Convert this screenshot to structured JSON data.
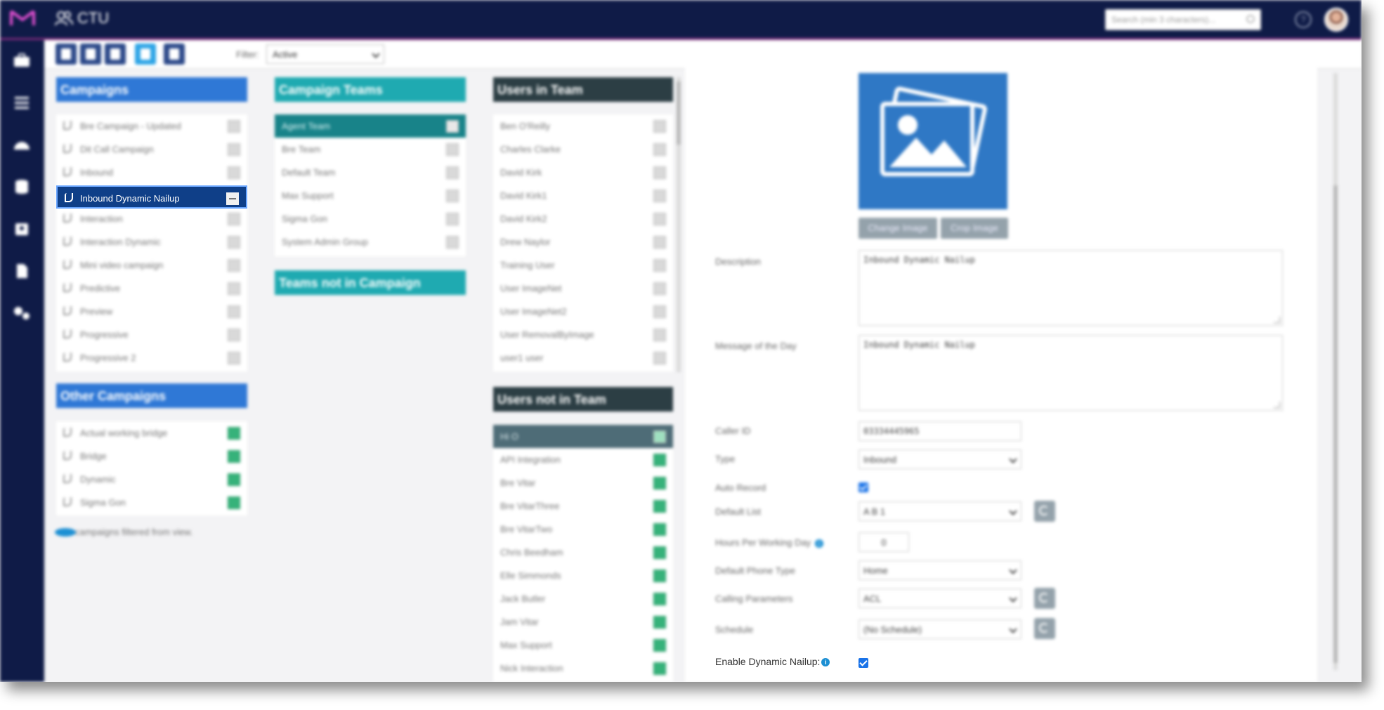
{
  "app": {
    "title": "CTU"
  },
  "header": {
    "search_placeholder": "Search (min 3 characters)...",
    "help": "?"
  },
  "toolbar": {
    "filter_label": "Filter:",
    "filter_value": "Active"
  },
  "campaigns": {
    "title": "Campaigns",
    "items": [
      {
        "label": "Bre Campaign - Updated"
      },
      {
        "label": "Dit Call Campaign"
      },
      {
        "label": "Inbound"
      },
      {
        "label": "Inbound Dynamic Nailup",
        "selected": true
      },
      {
        "label": "Interaction"
      },
      {
        "label": "Interaction Dynamic"
      },
      {
        "label": "Mini video campaign"
      },
      {
        "label": "Predictive"
      },
      {
        "label": "Preview"
      },
      {
        "label": "Progressive"
      },
      {
        "label": "Progressive 2"
      }
    ]
  },
  "other_campaigns": {
    "title": "Other Campaigns",
    "items": [
      {
        "label": "Actual working bridge"
      },
      {
        "label": "Bridge"
      },
      {
        "label": "Dynamic"
      },
      {
        "label": "Sigma Gon"
      }
    ],
    "note": "5 campaigns filtered from view."
  },
  "campaign_teams": {
    "title": "Campaign Teams",
    "items": [
      {
        "label": "Agent Team",
        "selected": true
      },
      {
        "label": "Bre Team"
      },
      {
        "label": "Default Team"
      },
      {
        "label": "Max Support"
      },
      {
        "label": "Sigma Gon"
      },
      {
        "label": "System Admin Group"
      }
    ]
  },
  "teams_not_in_campaign": {
    "title": "Teams not in Campaign"
  },
  "users_in_team": {
    "title": "Users in Team",
    "items": [
      {
        "label": "Ben O'Reilly"
      },
      {
        "label": "Charles Clarke"
      },
      {
        "label": "David Kirk"
      },
      {
        "label": "David Kirk1"
      },
      {
        "label": "David Kirk2"
      },
      {
        "label": "Drew Naylor"
      },
      {
        "label": "Training User"
      },
      {
        "label": "User ImageNet"
      },
      {
        "label": "User ImageNet2"
      },
      {
        "label": "User RemovalByImage"
      },
      {
        "label": "user1 user"
      }
    ]
  },
  "users_not_in_team": {
    "title": "Users not in Team",
    "items": [
      {
        "label": "Hi O",
        "selected": true
      },
      {
        "label": "API Integration"
      },
      {
        "label": "Bre Vitar"
      },
      {
        "label": "Bre VitarThree"
      },
      {
        "label": "Bre VitarTwo"
      },
      {
        "label": "Chris Beedham"
      },
      {
        "label": "Elle Simmonds"
      },
      {
        "label": "Jack Butler"
      },
      {
        "label": "Jam Vitar"
      },
      {
        "label": "Max Support"
      },
      {
        "label": "Nick Interaction"
      }
    ]
  },
  "form": {
    "change_image": "Change Image",
    "crop_image": "Crop Image",
    "description_label": "Description",
    "description_value": "Inbound Dynamic Nailup",
    "motd_label": "Message of the Day",
    "motd_value": "Inbound Dynamic Nailup",
    "caller_id_label": "Caller ID",
    "caller_id_value": "03334445965",
    "type_label": "Type",
    "type_value": "Inbound",
    "auto_record_label": "Auto Record",
    "default_list_label": "Default List",
    "default_list_value": "A B 1",
    "hours_label": "Hours Per Working Day",
    "hours_value": "0",
    "phone_type_label": "Default Phone Type",
    "phone_type_value": "Home",
    "calling_params_label": "Calling Parameters",
    "calling_params_value": "ACL",
    "schedule_label": "Schedule",
    "schedule_value": "(No Schedule)",
    "dynamic_nailup_label": "Enable Dynamic Nailup:",
    "info_glyph": "i"
  },
  "colors": {
    "topbar": "#0f1b47",
    "campaigns_header": "#2f78d6",
    "teams_header": "#1faab1",
    "users_header": "#2c3e44",
    "selected_campaign": "#0f3f88",
    "available": "#36b27a"
  }
}
